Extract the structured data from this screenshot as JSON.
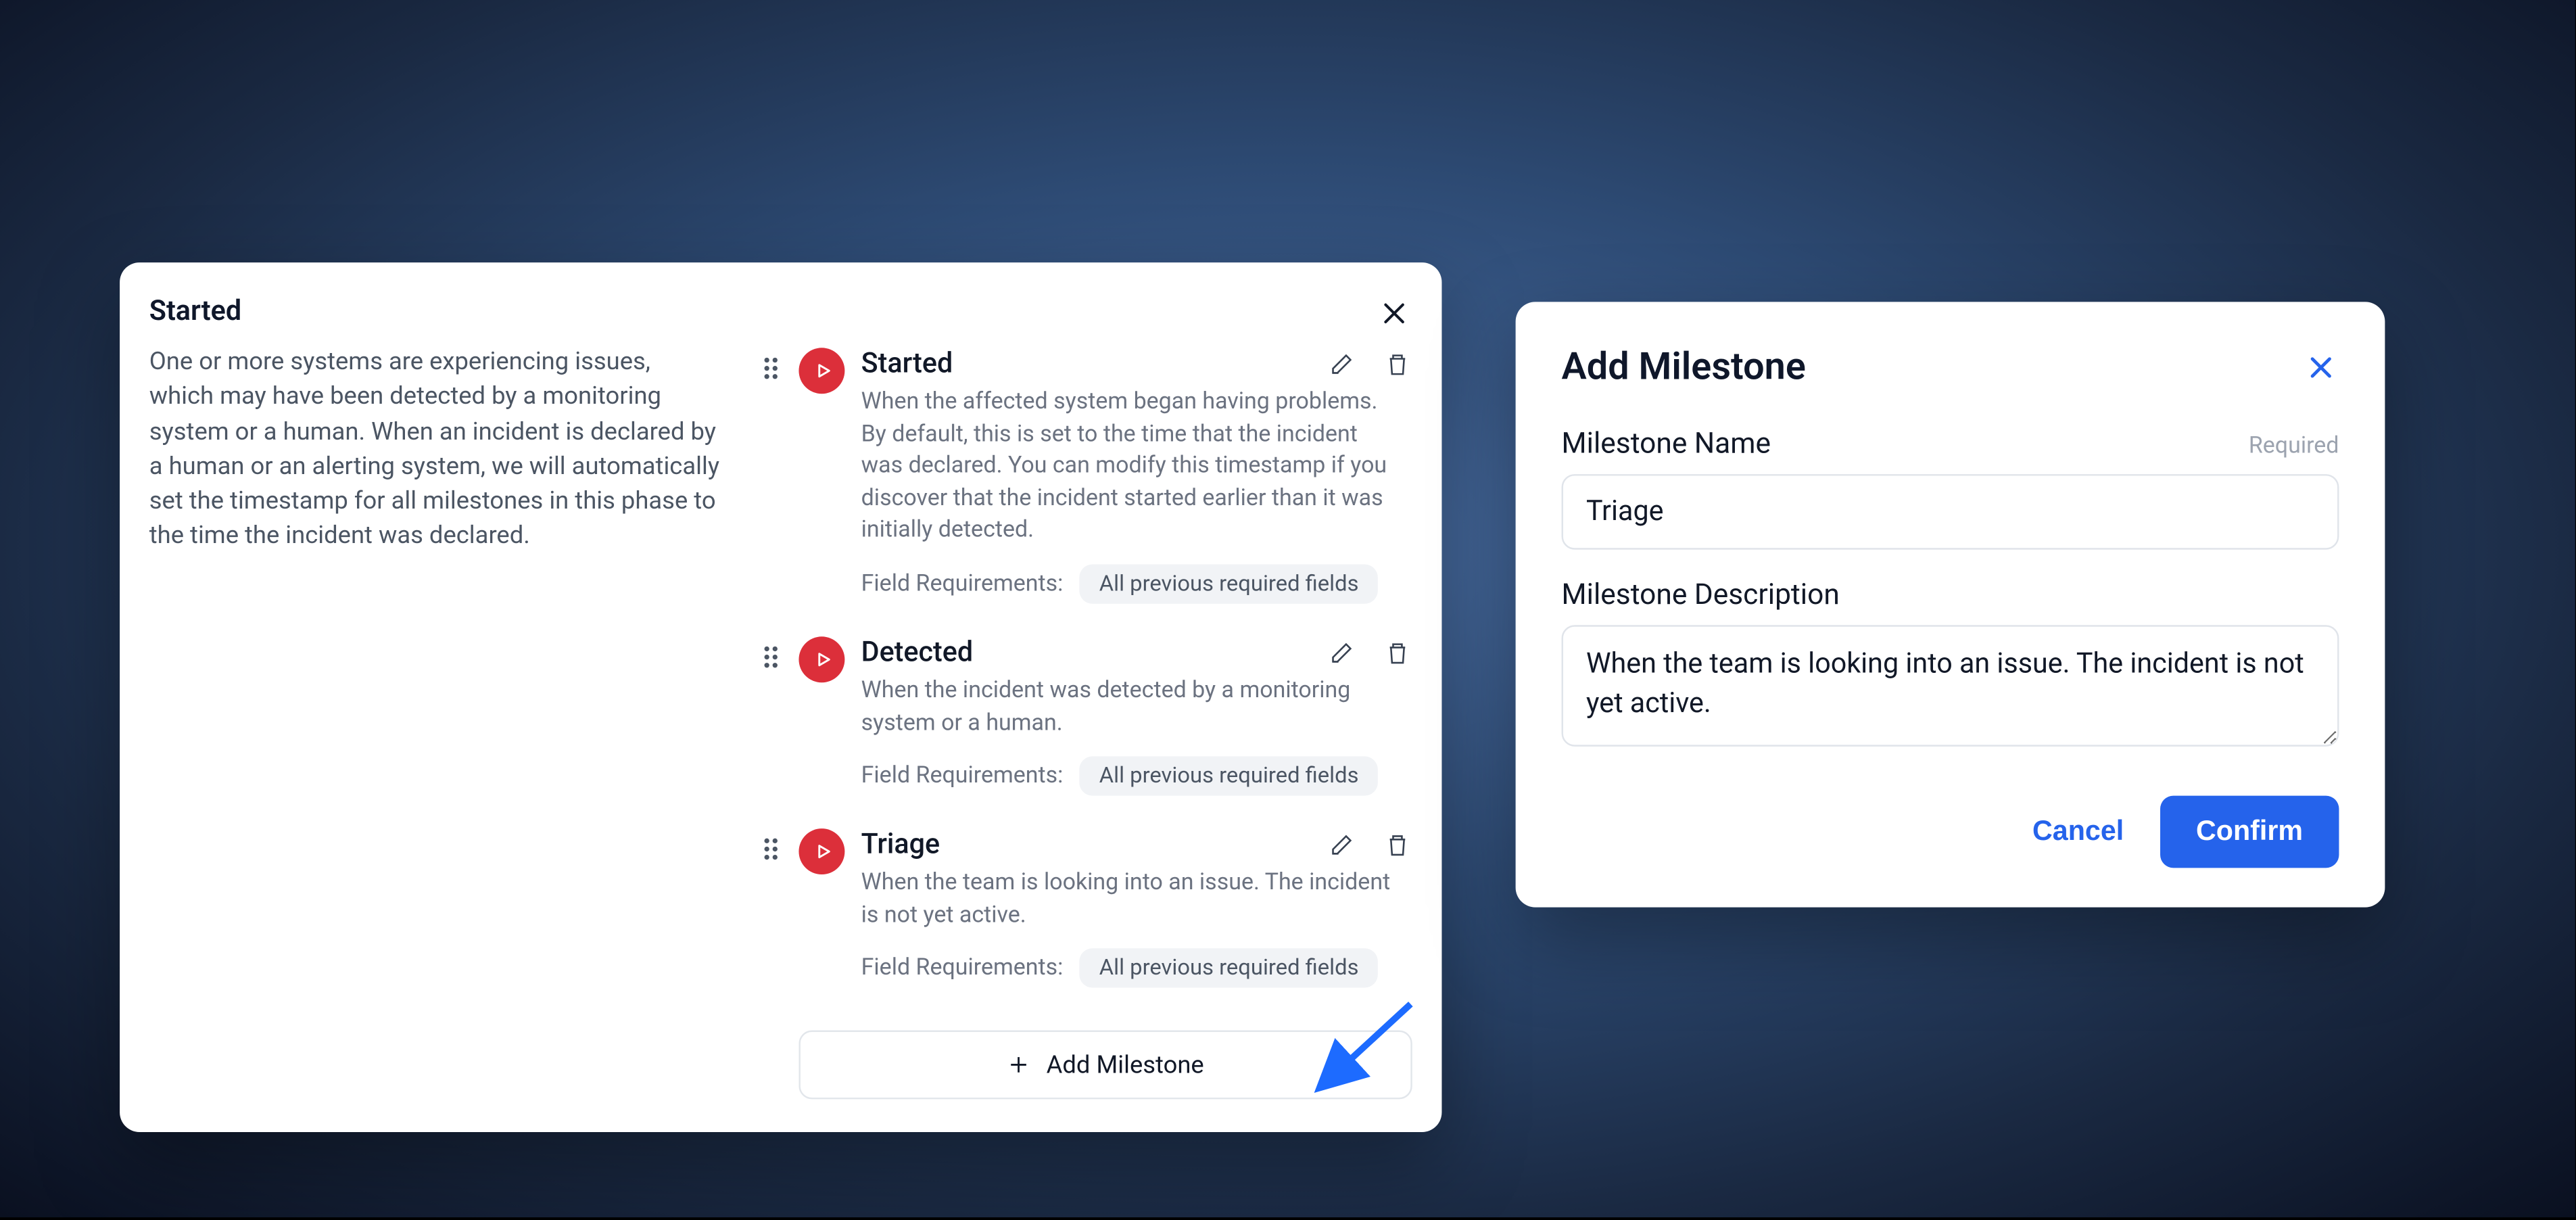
{
  "leftPanel": {
    "title": "Started",
    "description": "One or more systems are experiencing issues, which may have been detected by a monitoring system or a human. When an incident is declared by a human or an alerting system, we will automatically set the timestamp for all milestones in this phase to the time the incident was declared.",
    "field_req_label": "Field Requirements:",
    "field_req_value": "All previous required fields",
    "add_button_label": "Add Milestone",
    "milestones": [
      {
        "name": "Started",
        "description": "When the affected system began having problems. By default, this is set to the time that the incident was declared. You can modify this timestamp if you discover that the incident started earlier than it was initially detected."
      },
      {
        "name": "Detected",
        "description": "When the incident was detected by a monitoring system or a human."
      },
      {
        "name": "Triage",
        "description": "When the team is looking into an issue. The incident is not yet active."
      }
    ]
  },
  "dialog": {
    "title": "Add Milestone",
    "name_label": "Milestone Name",
    "required_label": "Required",
    "name_value": "Triage",
    "desc_label": "Milestone Description",
    "desc_value": "When the team is looking into an issue. The incident is not yet active.",
    "cancel_label": "Cancel",
    "confirm_label": "Confirm"
  }
}
